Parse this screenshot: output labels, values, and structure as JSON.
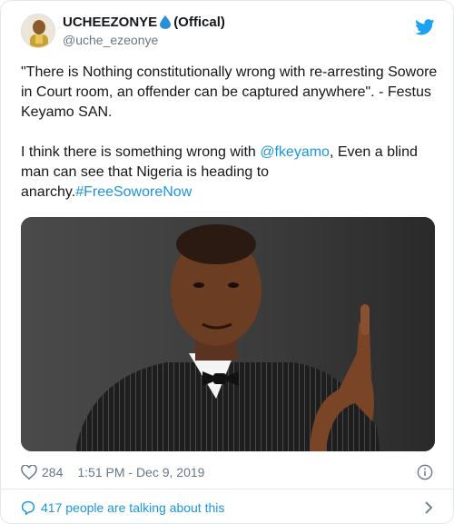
{
  "user": {
    "display_name": "UCHEEZONYE",
    "display_suffix": "(Offical)",
    "handle": "@uche_ezeonye"
  },
  "tweet": {
    "paragraph1": "\"There is Nothing constitutionally wrong with re-arresting Sowore in Court room, an offender can be captured anywhere\". - Festus Keyamo SAN.",
    "p2_before": "I think there is something wrong with ",
    "mention": "@fkeyamo",
    "p2_middle": ", Even a blind man can see that Nigeria is heading to anarchy.",
    "hashtag": "#FreeSoworeNow"
  },
  "meta": {
    "like_count": "284",
    "timestamp": "1:51 PM - Dec 9, 2019"
  },
  "footer": {
    "conversation_label": "417 people are talking about this"
  },
  "icons": {
    "drop": "water-drop-icon",
    "brand": "twitter-bird-icon",
    "like": "heart-icon",
    "info": "info-icon",
    "reply": "speech-bubble-icon",
    "more": "chevron-right-icon"
  },
  "colors": {
    "link": "#1b95e0",
    "secondary_text": "#657786",
    "border": "#e1e8ed"
  }
}
